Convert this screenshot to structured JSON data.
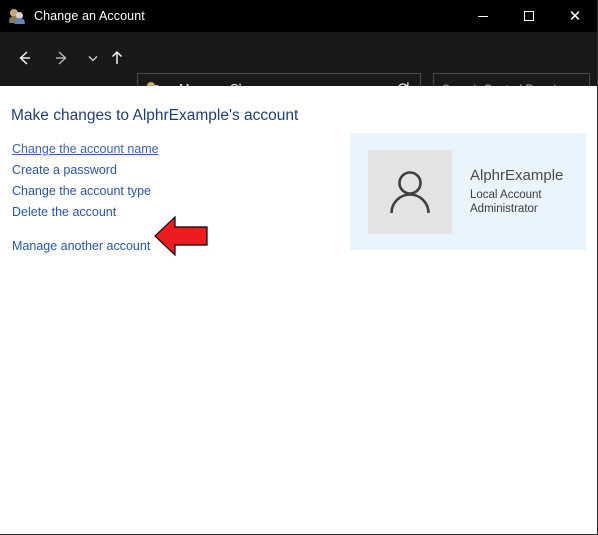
{
  "window": {
    "title": "Change an Account",
    "icon": "user-accounts-icon",
    "caption_buttons": {
      "minimize": "–",
      "maximize": "□",
      "close": "✕"
    }
  },
  "navbar": {
    "back_icon": "←",
    "forward_icon": "→",
    "recent_icon": "⌄",
    "up_icon": "↑",
    "address": {
      "icon": "user-accounts-icon",
      "chevrons": "«",
      "crumbs": [
        "Man...",
        "Change an ..."
      ],
      "separator": "›",
      "dropdown_icon": "⌄",
      "refresh_icon": "↻"
    },
    "search": {
      "placeholder": "Search Control Panel",
      "value": "",
      "icon": "search-icon"
    }
  },
  "content": {
    "heading": "Make changes to AlphrExample's account",
    "links": [
      {
        "label": "Change the account name",
        "hovered": true,
        "spaced": false
      },
      {
        "label": "Create a password",
        "hovered": false,
        "spaced": false
      },
      {
        "label": "Change the account type",
        "hovered": false,
        "spaced": false
      },
      {
        "label": "Delete the account",
        "hovered": false,
        "spaced": false
      },
      {
        "label": "Manage another account",
        "hovered": false,
        "spaced": true
      }
    ],
    "account": {
      "avatar_icon": "user-avatar-icon",
      "name": "AlphrExample",
      "type_line": "Local Account",
      "role_line": "Administrator",
      "panel_color": "#eaf4fd"
    },
    "annotation": {
      "shape": "left-pointing-arrow",
      "color": "#ee1c1c"
    }
  },
  "colors": {
    "titlebar_bg": "#000000",
    "navbar_bg": "#191919",
    "content_bg": "#ffffff",
    "link": "#2855a3",
    "heading": "#1f3f73",
    "accent_panel": "#eaf4fd"
  }
}
